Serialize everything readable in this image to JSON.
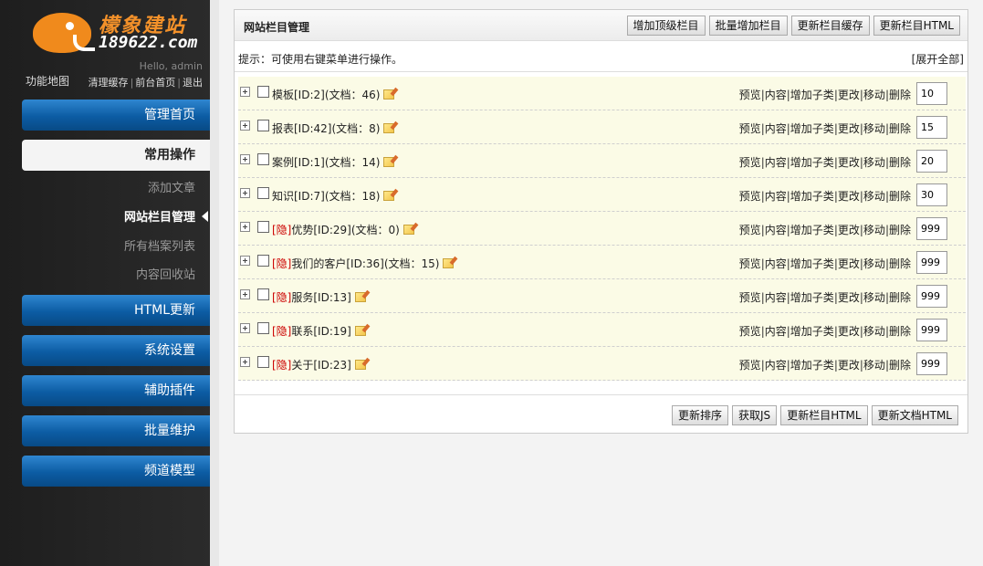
{
  "logo": {
    "text": "檬象建站",
    "sub": "189622.com"
  },
  "sidebar": {
    "hello": "Hello, admin",
    "sitemap": "功能地图",
    "links": [
      "清理缓存",
      "前台首页",
      "退出"
    ],
    "link_sep": "|",
    "nav": [
      {
        "label": "管理首页"
      },
      {
        "label": "常用操作"
      },
      {
        "label": "HTML更新"
      },
      {
        "label": "系统设置"
      },
      {
        "label": "辅助插件"
      },
      {
        "label": "批量维护"
      },
      {
        "label": "频道模型"
      }
    ],
    "sub_items": [
      "添加文章",
      "网站栏目管理",
      "所有档案列表",
      "内容回收站"
    ]
  },
  "panel": {
    "title": "网站栏目管理",
    "head_buttons": [
      "增加顶级栏目",
      "批量增加栏目",
      "更新栏目缓存",
      "更新栏目HTML"
    ],
    "tip": "提示：可使用右键菜单进行操作。",
    "expand_all": "[展开全部]",
    "rows": [
      {
        "hidden": "",
        "name": "模板[ID:2](文档：46)",
        "order": "10"
      },
      {
        "hidden": "",
        "name": "报表[ID:42](文档：8)",
        "order": "15"
      },
      {
        "hidden": "",
        "name": "案例[ID:1](文档：14)",
        "order": "20"
      },
      {
        "hidden": "",
        "name": "知识[ID:7](文档：18)",
        "order": "30"
      },
      {
        "hidden": "[隐]",
        "name": "优势[ID:29](文档：0)",
        "order": "999"
      },
      {
        "hidden": "[隐]",
        "name": "我们的客户[ID:36](文档：15)",
        "order": "999"
      },
      {
        "hidden": "[隐]",
        "name": "服务[ID:13]",
        "order": "999"
      },
      {
        "hidden": "[隐]",
        "name": "联系[ID:19]",
        "order": "999"
      },
      {
        "hidden": "[隐]",
        "name": "关于[ID:23]",
        "order": "999"
      }
    ],
    "row_ops": [
      "预览",
      "内容",
      "增加子类",
      "更改",
      "移动",
      "删除"
    ],
    "ops_sep": "|",
    "bottom_buttons": [
      "更新排序",
      "获取JS",
      "更新栏目HTML",
      "更新文档HTML"
    ]
  },
  "colors": {
    "nav_blue": "#0c5ca3",
    "hidden_red": "#cc0000",
    "row_bg": "#fbfbe6",
    "logo_orange": "#f08a1c"
  }
}
